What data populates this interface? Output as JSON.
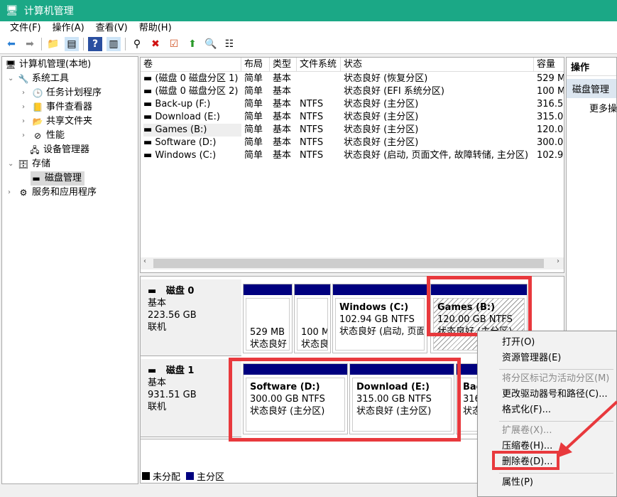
{
  "window": {
    "title": "计算机管理"
  },
  "menu": [
    "文件(F)",
    "操作(A)",
    "查看(V)",
    "帮助(H)"
  ],
  "toolbar_icons": [
    "back-icon",
    "forward-icon",
    "up-folder-icon",
    "show-hide-tree-icon",
    "help-icon",
    "show-hide-action-icon",
    "connect-icon",
    "delete-icon",
    "properties-icon",
    "import-icon",
    "search-icon",
    "list-icon"
  ],
  "tree": {
    "root": "计算机管理(本地)",
    "items": [
      {
        "label": "系统工具",
        "level": 1,
        "expanded": true
      },
      {
        "label": "任务计划程序",
        "level": 2
      },
      {
        "label": "事件查看器",
        "level": 2
      },
      {
        "label": "共享文件夹",
        "level": 2
      },
      {
        "label": "性能",
        "level": 2
      },
      {
        "label": "设备管理器",
        "level": 2
      },
      {
        "label": "存储",
        "level": 1,
        "expanded": true
      },
      {
        "label": "磁盘管理",
        "level": 2,
        "selected": true
      },
      {
        "label": "服务和应用程序",
        "level": 1
      }
    ]
  },
  "table": {
    "columns": [
      "卷",
      "布局",
      "类型",
      "文件系统",
      "状态",
      "容量"
    ],
    "rows": [
      [
        "(磁盘 0 磁盘分区 1)",
        "简单",
        "基本",
        "",
        "状态良好 (恢复分区)",
        "529 M"
      ],
      [
        "(磁盘 0 磁盘分区 2)",
        "简单",
        "基本",
        "",
        "状态良好 (EFI 系统分区)",
        "100 M"
      ],
      [
        "Back-up (F:)",
        "简单",
        "基本",
        "NTFS",
        "状态良好 (主分区)",
        "316.5"
      ],
      [
        "Download (E:)",
        "简单",
        "基本",
        "NTFS",
        "状态良好 (主分区)",
        "315.0"
      ],
      [
        "Games (B:)",
        "简单",
        "基本",
        "NTFS",
        "状态良好 (主分区)",
        "120.0"
      ],
      [
        "Software (D:)",
        "简单",
        "基本",
        "NTFS",
        "状态良好 (主分区)",
        "300.0"
      ],
      [
        "Windows (C:)",
        "简单",
        "基本",
        "NTFS",
        "状态良好 (启动, 页面文件, 故障转储, 主分区)",
        "102.9"
      ]
    ]
  },
  "actions": {
    "title": "操作",
    "section": "磁盘管理",
    "more": "更多操"
  },
  "disks": [
    {
      "name": "磁盘 0",
      "type": "基本",
      "size": "223.56 GB",
      "status": "联机",
      "partitions": [
        {
          "name": "",
          "size": "529 MB",
          "status": "状态良好"
        },
        {
          "name": "",
          "size": "100 M",
          "status": "状态良"
        },
        {
          "name": "Windows  (C:)",
          "size": "102.94 GB NTFS",
          "status": "状态良好 (启动, 页面"
        },
        {
          "name": "Games  (B:)",
          "size": "120.00 GB NTFS",
          "status": "状态良好 (主分区)"
        }
      ]
    },
    {
      "name": "磁盘 1",
      "type": "基本",
      "size": "931.51 GB",
      "status": "联机",
      "partitions": [
        {
          "name": "Software  (D:)",
          "size": "300.00 GB NTFS",
          "status": "状态良好 (主分区)"
        },
        {
          "name": "Download  (E:)",
          "size": "315.00 GB NTFS",
          "status": "状态良好 (主分区)"
        },
        {
          "name": "Bac",
          "size": "316.",
          "status": "状态"
        }
      ]
    }
  ],
  "legend": [
    {
      "label": "未分配",
      "color": "#000000"
    },
    {
      "label": "主分区",
      "color": "#00007f"
    }
  ],
  "context_menu": [
    {
      "label": "打开(O)",
      "enabled": true
    },
    {
      "label": "资源管理器(E)",
      "enabled": true
    },
    {
      "label": "将分区标记为活动分区(M)",
      "enabled": false
    },
    {
      "label": "更改驱动器号和路径(C)...",
      "enabled": true
    },
    {
      "label": "格式化(F)...",
      "enabled": true
    },
    {
      "label": "扩展卷(X)...",
      "enabled": false
    },
    {
      "label": "压缩卷(H)...",
      "enabled": true
    },
    {
      "label": "删除卷(D)...",
      "enabled": true,
      "highlighted": true
    },
    {
      "label": "属性(P)",
      "enabled": true
    }
  ]
}
